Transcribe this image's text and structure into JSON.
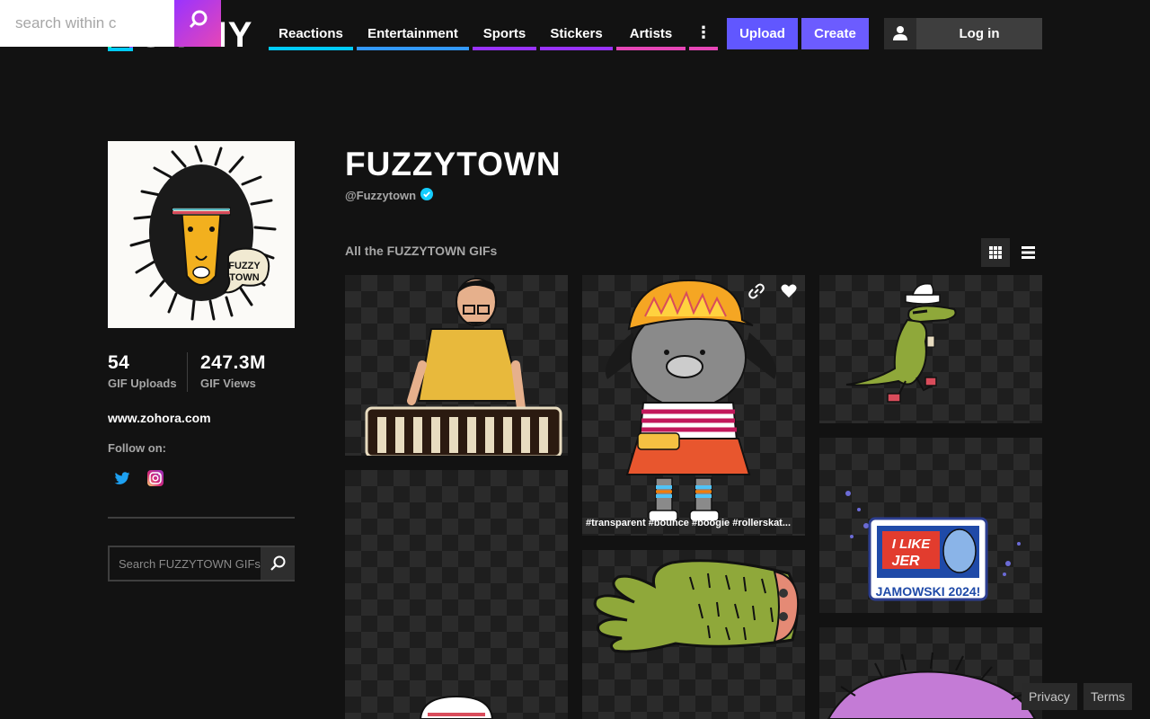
{
  "overlay_search": {
    "placeholder": "search within c"
  },
  "header": {
    "logo_text": "GIPHY",
    "nav": [
      {
        "label": "Reactions",
        "color": "#00ccff"
      },
      {
        "label": "Entertainment",
        "color": "#3399ff"
      },
      {
        "label": "Sports",
        "color": "#9933ff"
      },
      {
        "label": "Stickers",
        "color": "#9933ff"
      },
      {
        "label": "Artists",
        "color": "#e646b6"
      },
      {
        "label": "⋮",
        "color": "#e646b6"
      }
    ],
    "upload_label": "Upload",
    "create_label": "Create",
    "login_label": "Log in",
    "accent": "#6157ff"
  },
  "channel": {
    "title": "FUZZYTOWN",
    "handle": "@Fuzzytown",
    "avatar_text": "FUZZY TOWN",
    "stats": [
      {
        "value": "54",
        "label": "GIF Uploads"
      },
      {
        "value": "247.3M",
        "label": "GIF Views"
      }
    ],
    "website": "www.zohora.com",
    "follow_label": "Follow on:",
    "social": [
      "twitter-icon",
      "instagram-icon"
    ],
    "search_placeholder": "Search FUZZYTOWN GIFs"
  },
  "grid": {
    "section_label": "All the FUZZYTOWN GIFs",
    "tiles": [
      {
        "name": "gif-xylophone-man"
      },
      {
        "name": "gif-rollerskate-dog",
        "tags": "#transparent #bounce #boogie #rollerskat..."
      },
      {
        "name": "gif-cowboy-dinosaur"
      },
      {
        "name": "gif-empty"
      },
      {
        "name": "gif-hand-sleeve"
      },
      {
        "name": "gif-i-like-jer-sign",
        "sign_line1": "I LIKE",
        "sign_line2": "JER",
        "sign_line3": "JAMOWSKI 2024!"
      },
      {
        "name": "gif-purple-blob"
      }
    ]
  },
  "footer": {
    "privacy": "Privacy",
    "terms": "Terms"
  }
}
